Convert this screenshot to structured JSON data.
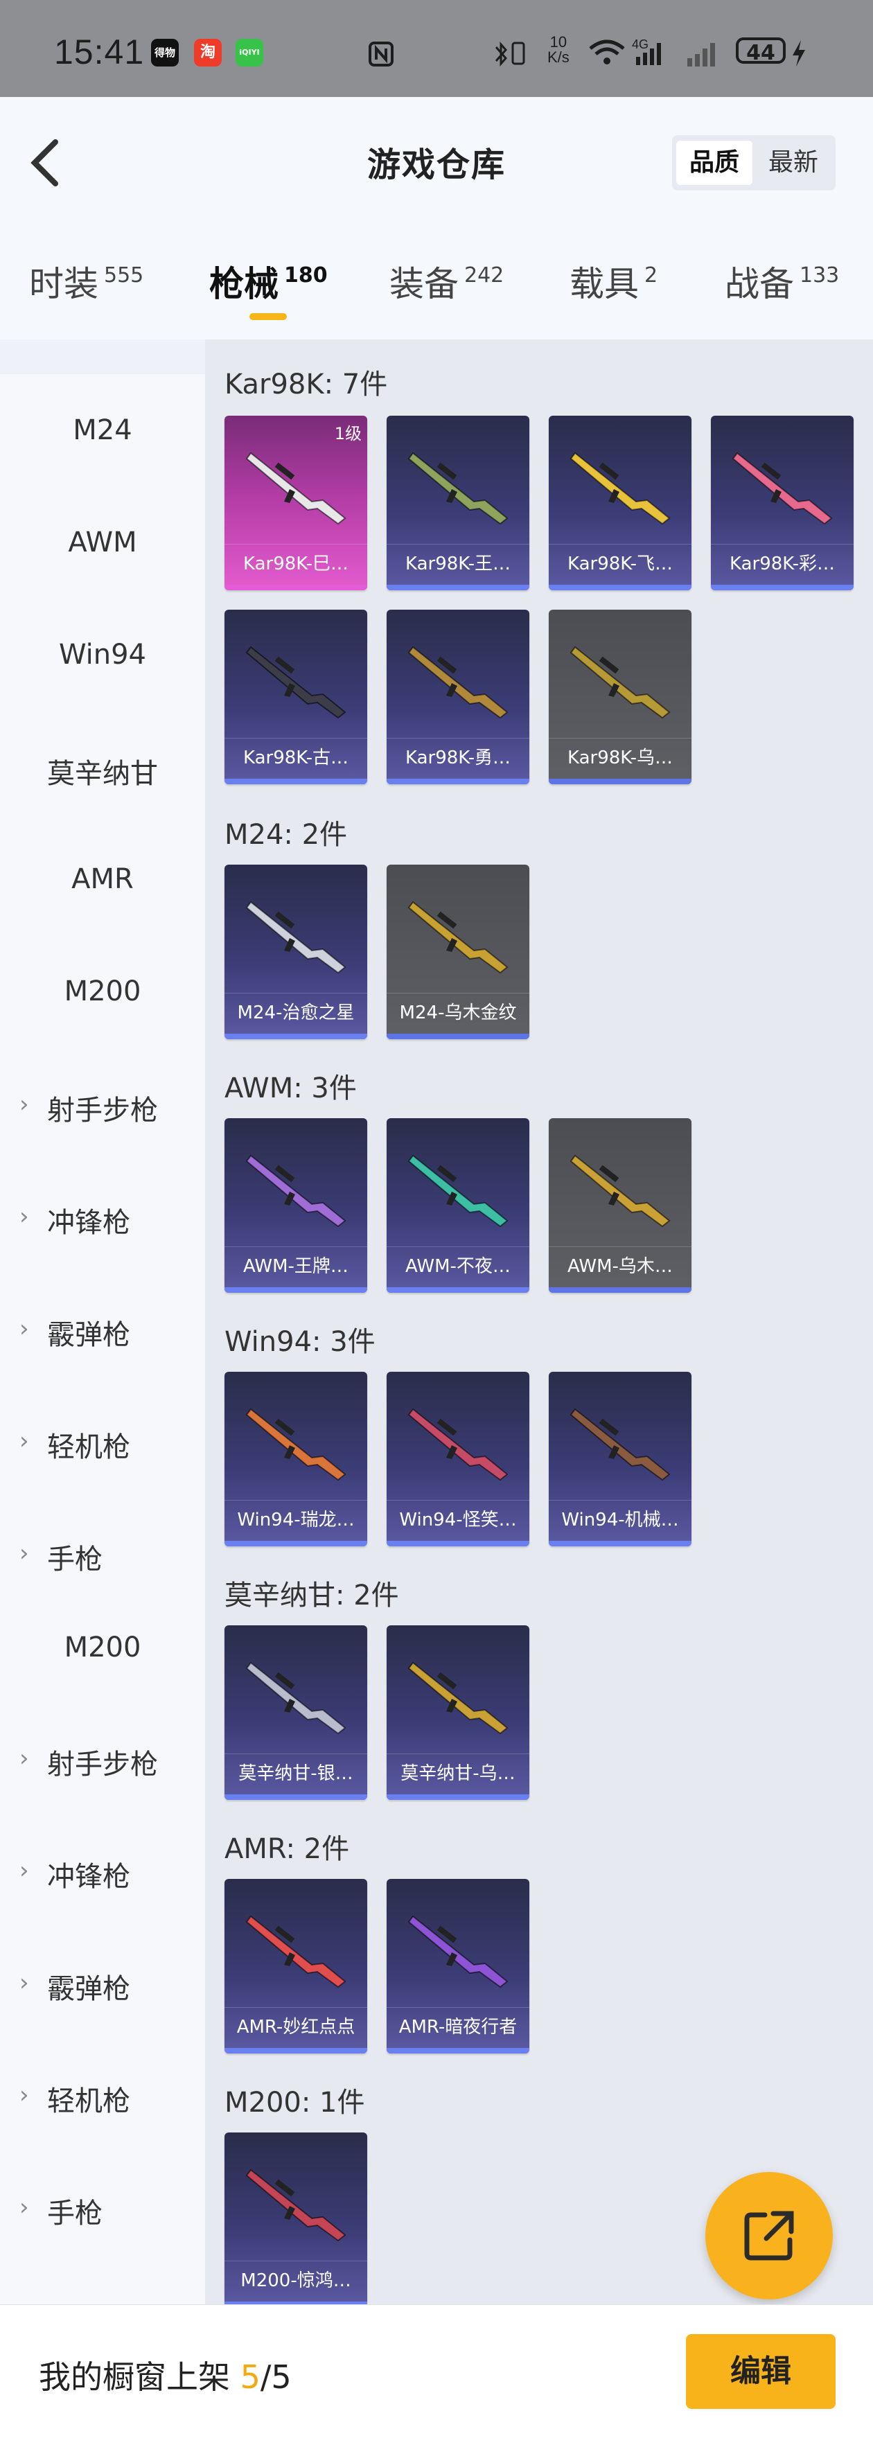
{
  "status_bar": {
    "time": "15:41",
    "apps": [
      {
        "name": "得物",
        "color": "#111111"
      },
      {
        "name": "淘",
        "color": "#ef3b2a"
      },
      {
        "name": "iQIYI",
        "color": "#37c34a"
      }
    ],
    "speed_top": "10",
    "speed_bottom": "K/s",
    "battery": "44"
  },
  "header": {
    "title": "游戏仓库",
    "sort_options": [
      "品质",
      "最新"
    ],
    "sort_active": "品质"
  },
  "tabs": [
    {
      "label": "时装",
      "count": "555"
    },
    {
      "label": "枪械",
      "count": "180",
      "active": true
    },
    {
      "label": "装备",
      "count": "242"
    },
    {
      "label": "载具",
      "count": "2"
    },
    {
      "label": "战备",
      "count": "133"
    }
  ],
  "sidebar": [
    {
      "label": "M24",
      "group": false
    },
    {
      "label": "AWM",
      "group": false
    },
    {
      "label": "Win94",
      "group": false
    },
    {
      "label": "莫辛纳甘",
      "group": false
    },
    {
      "label": "AMR",
      "group": false
    },
    {
      "label": "M200",
      "group": false
    },
    {
      "label": "射手步枪",
      "group": true
    },
    {
      "label": "冲锋枪",
      "group": true
    },
    {
      "label": "霰弹枪",
      "group": true
    },
    {
      "label": "轻机枪",
      "group": true
    },
    {
      "label": "手枪",
      "group": true
    },
    {
      "label": "M200",
      "group": false
    },
    {
      "label": "射手步枪",
      "group": true
    },
    {
      "label": "冲锋枪",
      "group": true
    },
    {
      "label": "霰弹枪",
      "group": true
    },
    {
      "label": "轻机枪",
      "group": true
    },
    {
      "label": "手枪",
      "group": true
    }
  ],
  "sections": [
    {
      "title": "Kar98K: 7件",
      "items": [
        {
          "label": "Kar98K-巳…",
          "style": "pink",
          "level": "1级",
          "gun_color": "#e8e8e8"
        },
        {
          "label": "Kar98K-王…",
          "style": "purple",
          "gun_color": "#8ea35b"
        },
        {
          "label": "Kar98K-飞…",
          "style": "purple",
          "gun_color": "#e7c23a"
        },
        {
          "label": "Kar98K-彩…",
          "style": "purple",
          "gun_color": "#e76a8e"
        },
        {
          "label": "Kar98K-古…",
          "style": "purple",
          "gun_color": "#3d3d4a"
        },
        {
          "label": "Kar98K-勇…",
          "style": "purple",
          "gun_color": "#b08a3a"
        },
        {
          "label": "Kar98K-乌…",
          "style": "gray",
          "gun_color": "#b59a35"
        }
      ]
    },
    {
      "title": "M24: 2件",
      "items": [
        {
          "label": "M24-治愈之星",
          "style": "purple",
          "gun_color": "#cfd2dc"
        },
        {
          "label": "M24-乌木金纹",
          "style": "gray",
          "gun_color": "#c7a233"
        }
      ]
    },
    {
      "title": "AWM: 3件",
      "items": [
        {
          "label": "AWM-王牌…",
          "style": "purple",
          "gun_color": "#a06cd8"
        },
        {
          "label": "AWM-不夜…",
          "style": "purple",
          "gun_color": "#3dbfa6"
        },
        {
          "label": "AWM-乌木…",
          "style": "gray",
          "gun_color": "#c9a135"
        }
      ]
    },
    {
      "title": "Win94: 3件",
      "items": [
        {
          "label": "Win94-瑞龙…",
          "style": "purple",
          "gun_color": "#d9743b"
        },
        {
          "label": "Win94-怪笑…",
          "style": "purple",
          "gun_color": "#c64b67"
        },
        {
          "label": "Win94-机械…",
          "style": "purple",
          "gun_color": "#8a5b3f"
        }
      ]
    },
    {
      "title": "莫辛纳甘: 2件",
      "items": [
        {
          "label": "莫辛纳甘-银…",
          "style": "purple",
          "gun_color": "#b9bccc"
        },
        {
          "label": "莫辛纳甘-乌…",
          "style": "purple",
          "gun_color": "#c9a135"
        }
      ]
    },
    {
      "title": "AMR: 2件",
      "items": [
        {
          "label": "AMR-妙红点点",
          "style": "purple",
          "gun_color": "#e04e4e"
        },
        {
          "label": "AMR-暗夜行者",
          "style": "purple",
          "gun_color": "#8d55d6"
        }
      ]
    },
    {
      "title": "M200: 1件",
      "items": [
        {
          "label": "M200-惊鸿…",
          "style": "purple",
          "gun_color": "#c44656"
        }
      ]
    }
  ],
  "bottom_bar": {
    "prefix": "我的橱窗上架",
    "count": "5",
    "total": "/5",
    "edit_label": "编辑"
  }
}
